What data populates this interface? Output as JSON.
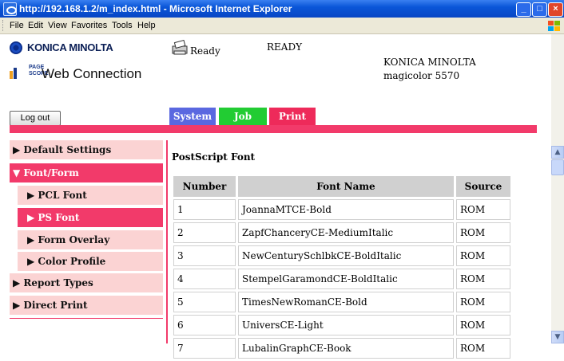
{
  "window": {
    "title": "http://192.168.1.2/m_index.html - Microsoft Internet Explorer",
    "buttons": [
      "_",
      "□",
      "×"
    ]
  },
  "menubar": {
    "items": [
      "File",
      "Edit",
      "View",
      "Favorites",
      "Tools",
      "Help"
    ]
  },
  "header": {
    "brand": "KONICA MINOLTA",
    "pagescope_small": "PAGE SCOPE",
    "web_connection": "Web Connection",
    "status_small": "Ready",
    "status_big": "READY",
    "device_brand": "KONICA MINOLTA",
    "device_model": "magicolor 5570",
    "logout_label": "Log out"
  },
  "tabs": [
    {
      "label": "System",
      "color": "#5a68e0"
    },
    {
      "label": "Job",
      "color": "#22cc33"
    },
    {
      "label": "Print",
      "color": "#ee2a5a"
    }
  ],
  "sidebar": {
    "items": [
      {
        "label": "▶ Default Settings"
      },
      {
        "label": "▼ Font/Form"
      },
      {
        "label": "▶ PCL Font"
      },
      {
        "label": "▶ PS Font"
      },
      {
        "label": "▶ Form Overlay"
      },
      {
        "label": "▶ Color Profile"
      },
      {
        "label": "▶ Report Types"
      },
      {
        "label": "▶ Direct Print"
      }
    ]
  },
  "main": {
    "title": "PostScript Font",
    "columns": [
      "Number",
      "Font Name",
      "Source"
    ],
    "rows": [
      [
        "1",
        "JoannaMTCE-Bold",
        "ROM"
      ],
      [
        "2",
        "ZapfChanceryCE-MediumItalic",
        "ROM"
      ],
      [
        "3",
        "NewCenturySchlbkCE-BoldItalic",
        "ROM"
      ],
      [
        "4",
        "StempelGaramondCE-BoldItalic",
        "ROM"
      ],
      [
        "5",
        "TimesNewRomanCE-Bold",
        "ROM"
      ],
      [
        "6",
        "UniversCE-Light",
        "ROM"
      ],
      [
        "7",
        "LubalinGraphCE-Book",
        "ROM"
      ]
    ]
  },
  "colors": {
    "accent_pink": "#f23a6a",
    "sidebar_bg": "#fbd3d3",
    "table_header": "#d0d0d0"
  }
}
